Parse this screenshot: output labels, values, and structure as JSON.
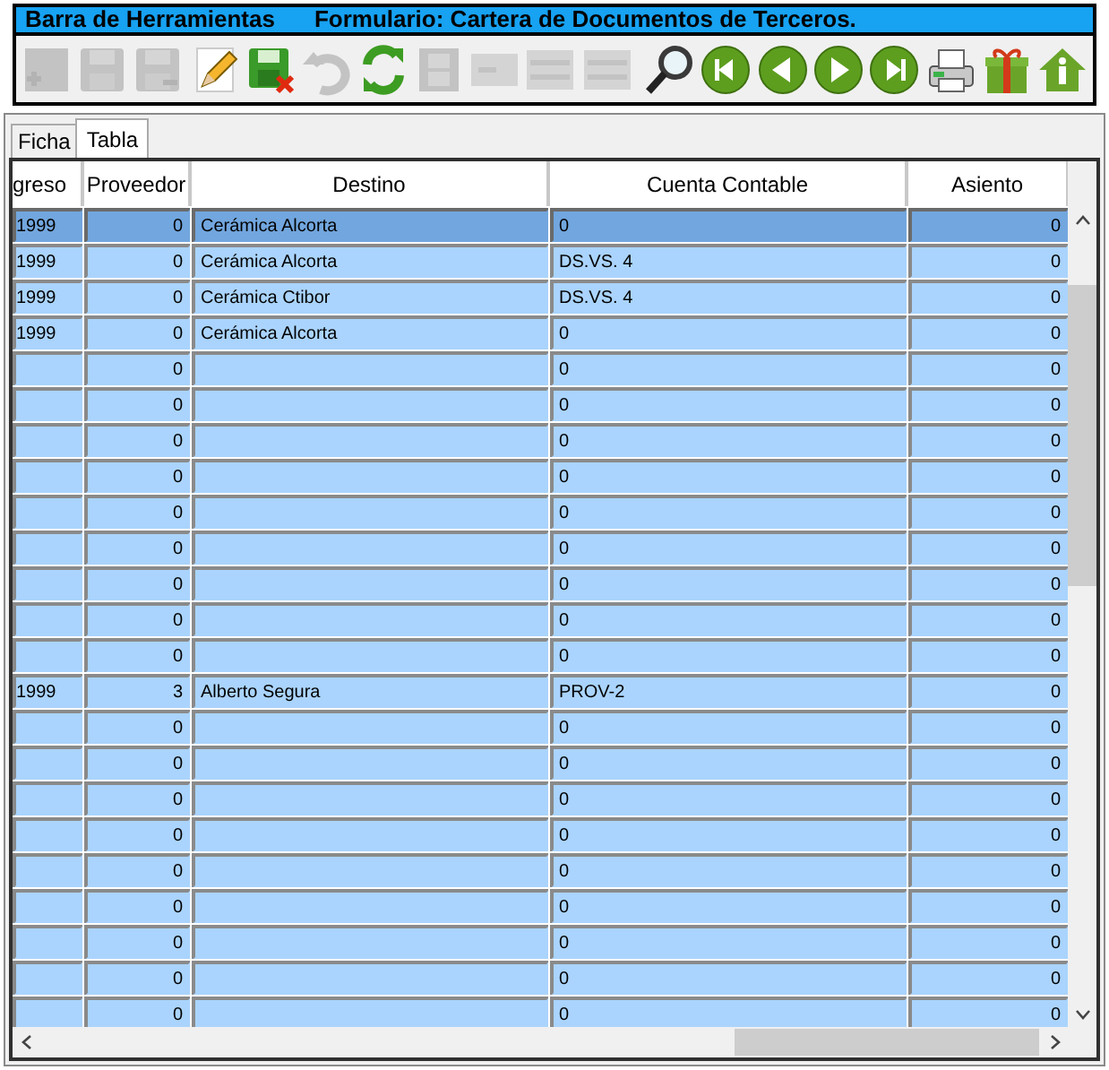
{
  "title_bar": {
    "left": "Barra de Herramientas",
    "right": "Formulario: Cartera de Documentos de Terceros."
  },
  "toolbar": [
    {
      "kind": "add",
      "disabled": true
    },
    {
      "kind": "save",
      "disabled": true
    },
    {
      "kind": "save-as",
      "disabled": true
    },
    {
      "kind": "edit",
      "disabled": false
    },
    {
      "kind": "cancel",
      "disabled": false
    },
    {
      "kind": "undo",
      "disabled": true
    },
    {
      "kind": "refresh",
      "disabled": false
    },
    {
      "kind": "film",
      "disabled": true
    },
    {
      "kind": "insert",
      "disabled": true
    },
    {
      "kind": "list",
      "disabled": true
    },
    {
      "kind": "list",
      "disabled": true
    },
    {
      "kind": "search",
      "disabled": false
    },
    {
      "kind": "first",
      "disabled": false
    },
    {
      "kind": "prev",
      "disabled": false
    },
    {
      "kind": "next",
      "disabled": false
    },
    {
      "kind": "last",
      "disabled": false
    },
    {
      "kind": "print",
      "disabled": false
    },
    {
      "kind": "gift",
      "disabled": false
    },
    {
      "kind": "home",
      "disabled": false
    }
  ],
  "tabs": [
    {
      "label": "Ficha",
      "selected": false
    },
    {
      "label": "Tabla",
      "selected": true
    }
  ],
  "table": {
    "columns": [
      "greso",
      "Proveedor",
      "Destino",
      "Cuenta Contable",
      "Asiento"
    ],
    "rows": [
      {
        "column_1": "1999",
        "proveedor": "0",
        "destino": "Cerámica Alcorta",
        "cuenta_contable": "0",
        "asiento": "0",
        "selected": true
      },
      {
        "column_1": "1999",
        "proveedor": "0",
        "destino": "Cerámica Alcorta",
        "cuenta_contable": "DS.VS. 4",
        "asiento": "0",
        "selected": false
      },
      {
        "column_1": "1999",
        "proveedor": "0",
        "destino": "Cerámica Ctibor",
        "cuenta_contable": "DS.VS. 4",
        "asiento": "0",
        "selected": false
      },
      {
        "column_1": "1999",
        "proveedor": "0",
        "destino": "Cerámica Alcorta",
        "cuenta_contable": "0",
        "asiento": "0",
        "selected": false
      },
      {
        "proveedor": "0",
        "cuenta_contable": "0",
        "asiento": "0",
        "selected": false
      },
      {
        "proveedor": "0",
        "cuenta_contable": "0",
        "asiento": "0",
        "selected": false
      },
      {
        "proveedor": "0",
        "cuenta_contable": "0",
        "asiento": "0",
        "selected": false
      },
      {
        "proveedor": "0",
        "cuenta_contable": "0",
        "asiento": "0",
        "selected": false
      },
      {
        "proveedor": "0",
        "cuenta_contable": "0",
        "asiento": "0",
        "selected": false
      },
      {
        "proveedor": "0",
        "cuenta_contable": "0",
        "asiento": "0",
        "selected": false
      },
      {
        "proveedor": "0",
        "cuenta_contable": "0",
        "asiento": "0",
        "selected": false
      },
      {
        "proveedor": "0",
        "cuenta_contable": "0",
        "asiento": "0",
        "selected": false
      },
      {
        "proveedor": "0",
        "cuenta_contable": "0",
        "asiento": "0",
        "selected": false
      },
      {
        "column_1": "1999",
        "proveedor": "3",
        "destino": "Alberto Segura",
        "cuenta_contable": "PROV-2",
        "asiento": "0",
        "selected": false
      },
      {
        "proveedor": "0",
        "cuenta_contable": "0",
        "asiento": "0",
        "selected": false
      },
      {
        "proveedor": "0",
        "cuenta_contable": "0",
        "asiento": "0",
        "selected": false
      },
      {
        "proveedor": "0",
        "cuenta_contable": "0",
        "asiento": "0",
        "selected": false
      },
      {
        "proveedor": "0",
        "cuenta_contable": "0",
        "asiento": "0",
        "selected": false
      },
      {
        "proveedor": "0",
        "cuenta_contable": "0",
        "asiento": "0",
        "selected": false
      },
      {
        "proveedor": "0",
        "cuenta_contable": "0",
        "asiento": "0",
        "selected": false
      },
      {
        "proveedor": "0",
        "cuenta_contable": "0",
        "asiento": "0",
        "selected": false
      },
      {
        "proveedor": "0",
        "cuenta_contable": "0",
        "asiento": "0",
        "selected": false
      },
      {
        "proveedor": "0",
        "cuenta_contable": "0",
        "asiento": "0",
        "selected": false
      }
    ]
  }
}
